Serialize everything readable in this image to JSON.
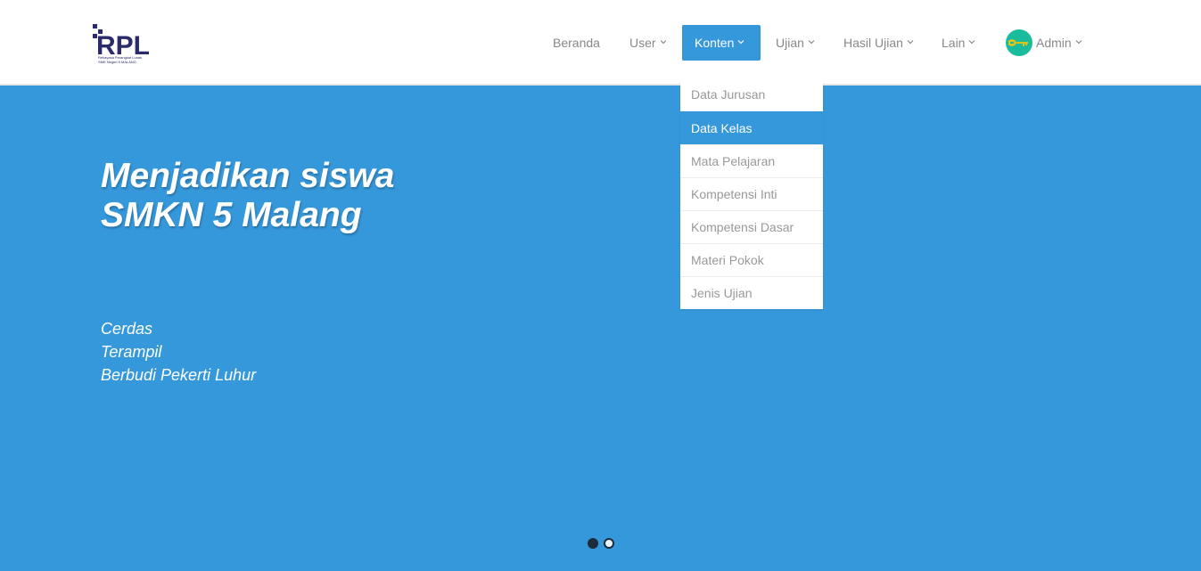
{
  "logo": {
    "text": "RPL",
    "caption_line1": "Rekayasa Perangkat Lunak",
    "caption_line2": "SMK Negeri 5 MALANG"
  },
  "nav": {
    "beranda": "Beranda",
    "user": "User",
    "konten": "Konten",
    "ujian": "Ujian",
    "hasil_ujian": "Hasil Ujian",
    "lain": "Lain",
    "admin": "Admin"
  },
  "dropdown": {
    "items": [
      "Data Jurusan",
      "Data Kelas",
      "Mata Pelajaran",
      "Kompetensi Inti",
      "Kompetensi Dasar",
      "Materi Pokok",
      "Jenis Ujian"
    ],
    "selected": "Data Kelas"
  },
  "hero": {
    "title_line1": "Menjadikan siswa",
    "title_line2": "SMKN 5 Malang",
    "sub_line1": "Cerdas",
    "sub_line2": "Terampil",
    "sub_line3": "Berbudi Pekerti Luhur"
  },
  "carousel": {
    "current": 1,
    "total": 2
  },
  "colors": {
    "primary": "#3598db",
    "avatar": "#1abc9c",
    "logo": "#2b2a6b",
    "key": "#f1c40f"
  }
}
